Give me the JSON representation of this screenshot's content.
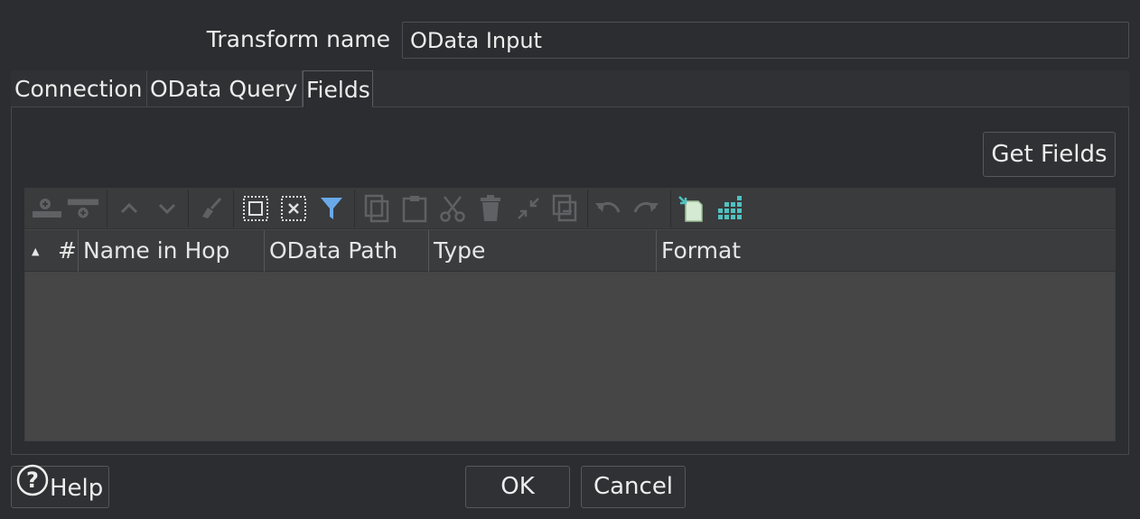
{
  "form": {
    "transform_name_label": "Transform name",
    "transform_name_value": "OData Input"
  },
  "tabs": [
    {
      "label": "Connection",
      "active": false
    },
    {
      "label": "OData Query",
      "active": false
    },
    {
      "label": "Fields",
      "active": true
    }
  ],
  "fields_tab": {
    "get_fields_label": "Get Fields",
    "toolbar_icons": [
      "insert-row-before-icon",
      "insert-row-after-icon",
      "move-up-icon",
      "move-down-icon",
      "clean-icon",
      "select-all-icon",
      "clear-selection-icon",
      "filter-icon",
      "copy-icon",
      "paste-icon",
      "cut-icon",
      "delete-icon",
      "shrink-icon",
      "duplicate-icon",
      "undo-icon",
      "redo-icon",
      "get-fields-icon",
      "optimal-column-width-icon"
    ],
    "columns": [
      "",
      "#",
      "Name in Hop",
      "OData Path",
      "Type",
      "Format"
    ],
    "rows": []
  },
  "footer": {
    "help_label": "Help",
    "ok_label": "OK",
    "cancel_label": "Cancel"
  },
  "colors": {
    "background": "#2b2d30",
    "grid_background": "#454545",
    "accent_teal": "#4fc3c0",
    "filter_blue": "#6aa9e9"
  }
}
